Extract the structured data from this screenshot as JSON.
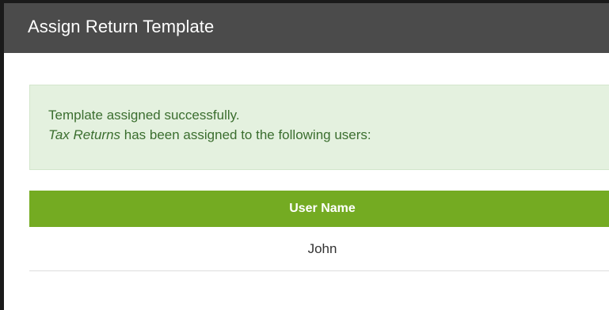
{
  "dialog": {
    "title": "Assign Return Template"
  },
  "alert": {
    "line1": "Template assigned successfully.",
    "template_name": "Tax Returns",
    "line2_suffix": " has been assigned to the following users:"
  },
  "table": {
    "header": "User Name",
    "rows": [
      {
        "user_name": "John"
      },
      {
        "user_name": ""
      }
    ]
  },
  "colors": {
    "header_bg": "#4b4b4b",
    "alert_bg": "#e4f1df",
    "alert_text": "#3b6e2f",
    "table_header_bg": "#74ab22"
  }
}
